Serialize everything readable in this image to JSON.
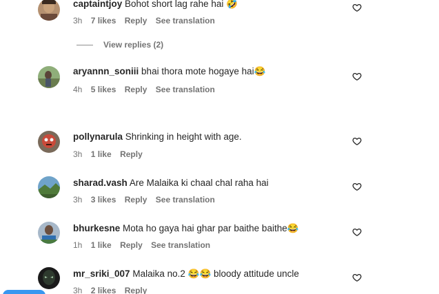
{
  "comments": [
    {
      "username": "captaintjoy",
      "text": "Bohot short lag rahe hai 🤣",
      "time": "3h",
      "likes": "7 likes",
      "reply": "Reply",
      "translation": "See translation"
    },
    {
      "username": "aryannn_soniii",
      "text": "bhai thora mote hogaye hai😂",
      "time": "4h",
      "likes": "5 likes",
      "reply": "Reply",
      "translation": "See translation"
    },
    {
      "username": "pollynarula",
      "text": "Shrinking in height with age.",
      "time": "3h",
      "likes": "1 like",
      "reply": "Reply",
      "translation": ""
    },
    {
      "username": "sharad.vash",
      "text": "Are Malaika ki chaal chal raha hai",
      "time": "3h",
      "likes": "3 likes",
      "reply": "Reply",
      "translation": "See translation"
    },
    {
      "username": "bhurkesne",
      "text": "Mota ho gaya hai ghar par baithe baithe😂",
      "time": "1h",
      "likes": "1 like",
      "reply": "Reply",
      "translation": "See translation"
    },
    {
      "username": "mr_sriki_007",
      "text": "Malaika no.2 😂😂 bloody attitude uncle",
      "time": "3h",
      "likes": "2 likes",
      "reply": "Reply",
      "translation": ""
    }
  ],
  "view_replies": "View replies (2)",
  "colors": {
    "text": "#262626",
    "secondary": "#737373",
    "accent": "#3897f0"
  },
  "icons": {
    "like": "heart-outline-icon"
  }
}
